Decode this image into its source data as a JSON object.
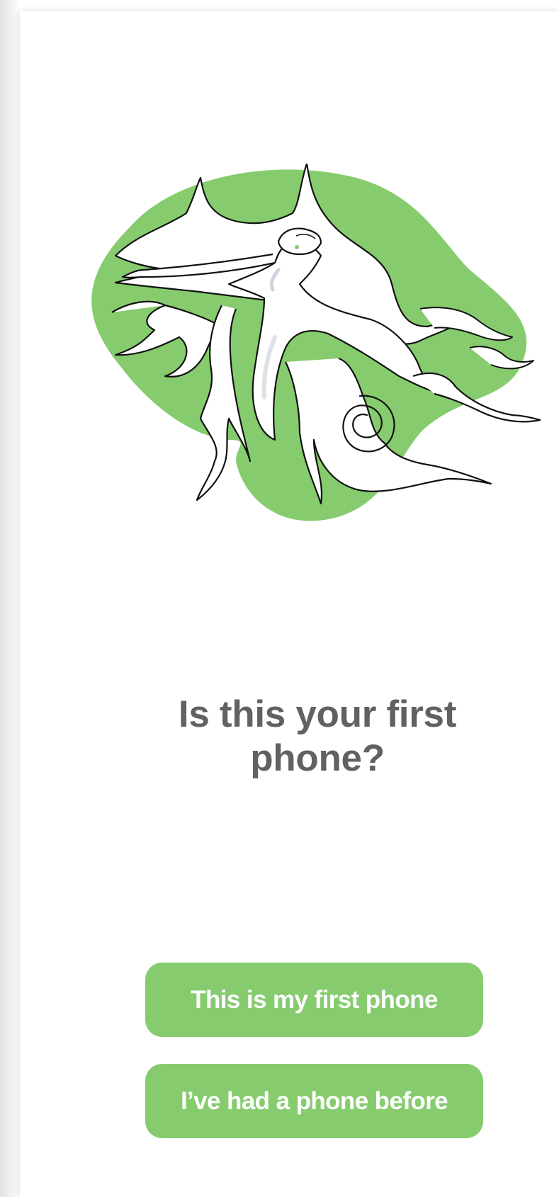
{
  "onboarding": {
    "question": "Is this your first phone?",
    "options": [
      {
        "label": "This is my first phone"
      },
      {
        "label": "I’ve had a phone before"
      }
    ]
  },
  "illustration": {
    "icon": "flying-figure-illustration",
    "accent_color": "#86cc6e",
    "line_color": "#111111"
  },
  "colors": {
    "button_background": "#86cc6e",
    "button_text": "#ffffff",
    "question_text": "#616161",
    "background": "#ffffff"
  }
}
